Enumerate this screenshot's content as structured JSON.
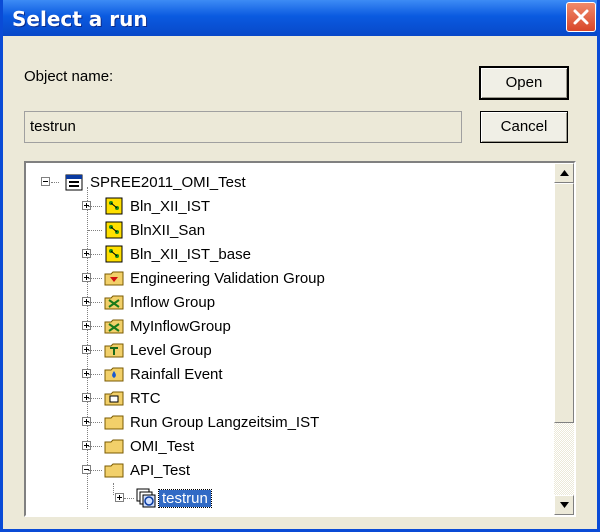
{
  "window": {
    "title": "Select a run"
  },
  "object_name": {
    "label": "Object name:",
    "value": "testrun"
  },
  "buttons": {
    "open": "Open",
    "cancel": "Cancel"
  },
  "tree": {
    "root": "SPREE2011_OMI_Test",
    "items": [
      {
        "label": "Bln_XII_IST",
        "icon": "run-group-icon",
        "expandable": true
      },
      {
        "label": "BlnXII_San",
        "icon": "run-group-icon",
        "expandable": false
      },
      {
        "label": "Bln_XII_IST_base",
        "icon": "run-group-icon",
        "expandable": true
      },
      {
        "label": "Engineering Validation Group",
        "icon": "validation-group-icon",
        "expandable": true
      },
      {
        "label": "Inflow Group",
        "icon": "inflow-group-icon",
        "expandable": true
      },
      {
        "label": "MyInflowGroup",
        "icon": "inflow-group-icon",
        "expandable": true
      },
      {
        "label": "Level Group",
        "icon": "level-group-icon",
        "expandable": true
      },
      {
        "label": "Rainfall Event",
        "icon": "rainfall-event-icon",
        "expandable": true
      },
      {
        "label": "RTC",
        "icon": "rtc-icon",
        "expandable": true
      },
      {
        "label": "Run Group Langzeitsim_IST",
        "icon": "folder-icon",
        "expandable": true
      },
      {
        "label": "OMI_Test",
        "icon": "folder-icon",
        "expandable": true
      },
      {
        "label": "API_Test",
        "icon": "folder-icon",
        "expandable": true,
        "expanded": true
      }
    ],
    "child": {
      "label": "testrun",
      "icon": "run-icon",
      "selected": true
    }
  },
  "colors": {
    "title_bar": "#0a5ae0",
    "selection": "#316ac5"
  }
}
